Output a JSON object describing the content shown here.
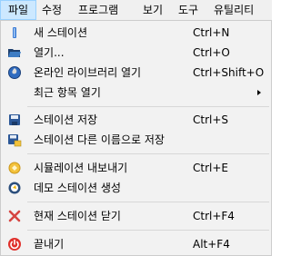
{
  "menubar": {
    "items": [
      {
        "label": "파일"
      },
      {
        "label": "수정"
      },
      {
        "label": "프로그램"
      },
      {
        "label": "보기"
      },
      {
        "label": "도구"
      },
      {
        "label": "유틸리티"
      }
    ]
  },
  "file_menu": {
    "items": [
      {
        "label": "새 스테이션",
        "shortcut": "Ctrl+N",
        "icon": "new-station-icon"
      },
      {
        "label": "열기...",
        "shortcut": "Ctrl+O",
        "icon": "open-folder-icon"
      },
      {
        "label": "온라인 라이브러리 열기",
        "shortcut": "Ctrl+Shift+O",
        "icon": "online-library-icon"
      },
      {
        "label": "최근 항목 열기",
        "shortcut": "",
        "icon": ""
      },
      {
        "label": "스테이션 저장",
        "shortcut": "Ctrl+S",
        "icon": "save-icon"
      },
      {
        "label": "스테이션 다른 이름으로 저장",
        "shortcut": "",
        "icon": "save-as-icon"
      },
      {
        "label": "시뮬레이션 내보내기",
        "shortcut": "Ctrl+E",
        "icon": "export-simulation-icon"
      },
      {
        "label": "데모 스테이션 생성",
        "shortcut": "",
        "icon": "demo-station-icon"
      },
      {
        "label": "현재 스테이션 닫기",
        "shortcut": "Ctrl+F4",
        "icon": "close-station-icon"
      },
      {
        "label": "끝내기",
        "shortcut": "Alt+F4",
        "icon": "exit-power-icon"
      }
    ]
  },
  "colors": {
    "menubar_bg": "#f0f0f0",
    "active_menu_bg": "#cce8ff",
    "dropdown_bg": "#f2f2f2",
    "separator": "#d7d7d7"
  }
}
